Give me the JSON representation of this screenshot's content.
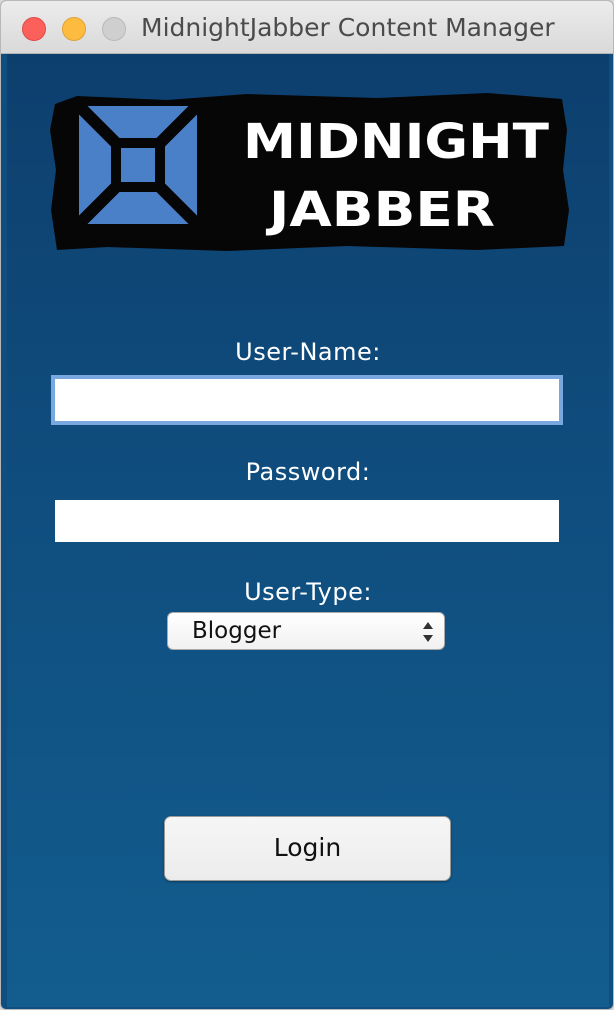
{
  "window": {
    "title": "MidnightJabber Content Manager"
  },
  "logo": {
    "line1": "MIDNIGHT",
    "line2": "JABBER"
  },
  "form": {
    "username_label": "User-Name:",
    "username_value": "",
    "password_label": "Password:",
    "password_value": "",
    "usertype_label": "User-Type:",
    "usertype_selected": "Blogger",
    "login_label": "Login"
  },
  "colors": {
    "background": "#0f4e7f",
    "focus_ring": "#78a8df",
    "logo_blue": "#4a80c8"
  }
}
